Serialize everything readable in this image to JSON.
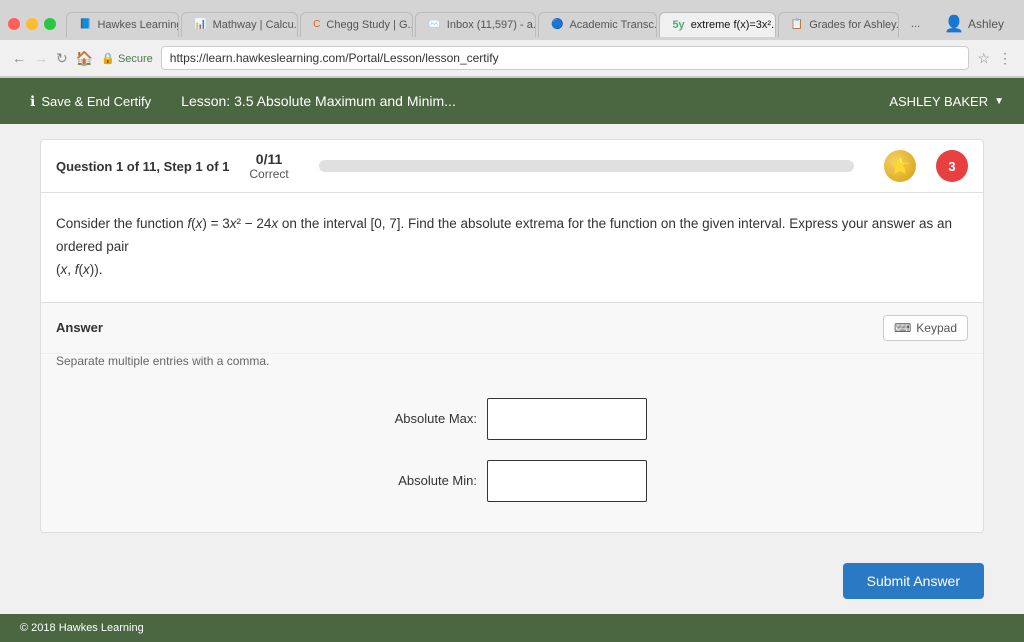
{
  "browser": {
    "tabs": [
      {
        "id": "hawkes",
        "favicon": "📘",
        "label": "Hawkes Learning",
        "active": false
      },
      {
        "id": "mathway",
        "favicon": "📊",
        "label": "Mathway | Calcu...",
        "active": false
      },
      {
        "id": "chegg",
        "favicon": "🟠",
        "label": "Chegg Study | G...",
        "active": false
      },
      {
        "id": "gmail",
        "favicon": "✉️",
        "label": "Inbox (11,597) - a...",
        "active": false
      },
      {
        "id": "academic",
        "favicon": "🔵",
        "label": "Academic Transc...",
        "active": false
      },
      {
        "id": "extreme",
        "favicon": "5y",
        "label": "extreme f(x)=3x²...",
        "active": true
      },
      {
        "id": "grades",
        "favicon": "📋",
        "label": "Grades for Ashley...",
        "active": false
      }
    ],
    "more_tabs": "...",
    "user": "Ashley",
    "url": "https://learn.hawkeslearning.com/Portal/Lesson/lesson_certify",
    "secure_label": "Secure"
  },
  "header": {
    "save_certify_label": "Save & End Certify",
    "lesson_title": "Lesson: 3.5 Absolute Maximum and Minim...",
    "user_name": "ASHLEY BAKER"
  },
  "question": {
    "label": "Question 1 of 11, Step 1 of 1",
    "score_current": "0/11",
    "score_label": "Correct",
    "progress_percent": 0,
    "body_line1": "Consider the function f(x) = 3x² − 24x on the interval [0, 7]. Find the absolute extrema for the function on the given interval. Express your answer as an ordered pair",
    "body_line2": "(x, f(x)).",
    "hearts": "3"
  },
  "answer": {
    "section_label": "Answer",
    "keypad_label": "Keypad",
    "separate_note": "Separate multiple entries with a comma.",
    "absolute_max_label": "Absolute Max:",
    "absolute_min_label": "Absolute Min:",
    "absolute_max_placeholder": "",
    "absolute_min_placeholder": ""
  },
  "submit": {
    "button_label": "Submit Answer"
  },
  "footer": {
    "copyright": "© 2018 Hawkes Learning"
  }
}
